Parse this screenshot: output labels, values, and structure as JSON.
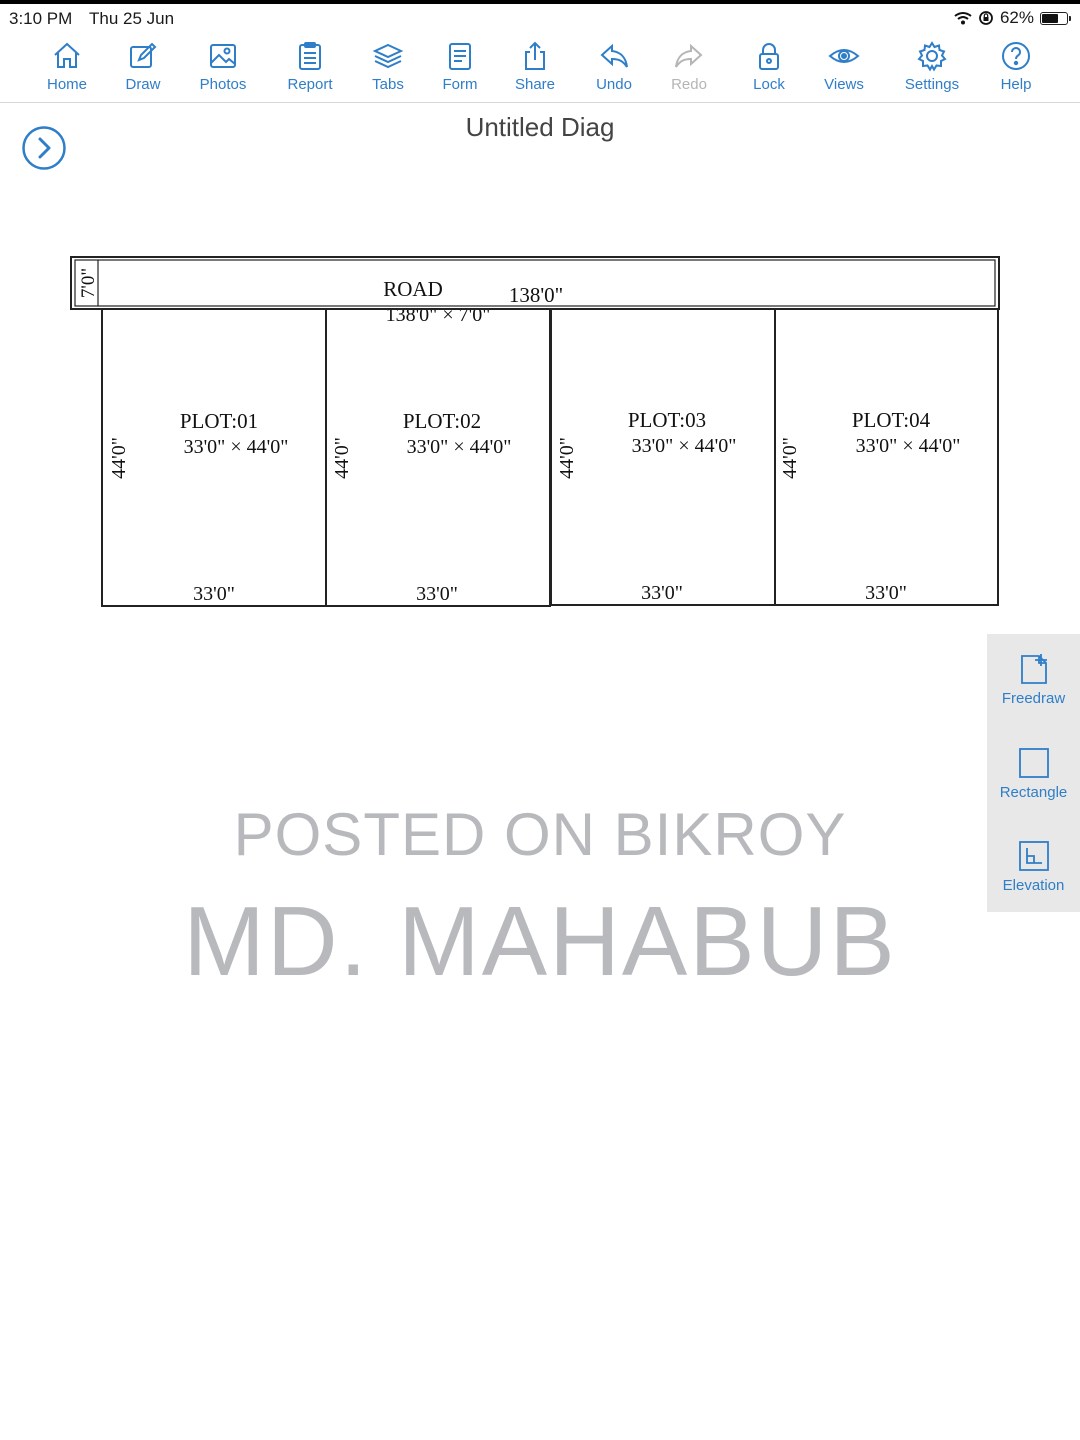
{
  "status": {
    "time": "3:10 PM",
    "date": "Thu 25 Jun",
    "battery": "62%"
  },
  "toolbar": [
    {
      "label": "Home",
      "icon": "home-icon"
    },
    {
      "label": "Draw",
      "icon": "draw-icon"
    },
    {
      "label": "Photos",
      "icon": "photos-icon"
    },
    {
      "label": "Report",
      "icon": "report-icon"
    },
    {
      "label": "Tabs",
      "icon": "tabs-icon"
    },
    {
      "label": "Form",
      "icon": "form-icon"
    },
    {
      "label": "Share",
      "icon": "share-icon"
    },
    {
      "label": "Undo",
      "icon": "undo-icon"
    },
    {
      "label": "Redo",
      "icon": "redo-icon"
    },
    {
      "label": "Lock",
      "icon": "lock-icon"
    },
    {
      "label": "Views",
      "icon": "views-icon"
    },
    {
      "label": "Settings",
      "icon": "settings-icon"
    },
    {
      "label": "Help",
      "icon": "help-icon"
    }
  ],
  "document": {
    "title": "Untitled Diag"
  },
  "drawing": {
    "road": {
      "label": "ROAD",
      "length": "138'0\"",
      "width": "7'0\"",
      "area": "138'0\" × 7'0\""
    },
    "plots": [
      {
        "name": "PLOT:01",
        "size": "33'0\" × 44'0\"",
        "depth": "44'0\"",
        "frontage": "33'0\""
      },
      {
        "name": "PLOT:02",
        "size": "33'0\" × 44'0\"",
        "depth": "44'0\"",
        "frontage": "33'0\""
      },
      {
        "name": "PLOT:03",
        "size": "33'0\" × 44'0\"",
        "depth": "44'0\"",
        "frontage": "33'0\""
      },
      {
        "name": "PLOT:04",
        "size": "33'0\" × 44'0\"",
        "depth": "44'0\"",
        "frontage": "33'0\""
      }
    ]
  },
  "side_tools": [
    {
      "label": "Freedraw",
      "icon": "freedraw-icon"
    },
    {
      "label": "Rectangle",
      "icon": "rectangle-icon"
    },
    {
      "label": "Elevation",
      "icon": "elevation-icon"
    }
  ],
  "watermark": {
    "line1": "POSTED ON BIKROY",
    "line2": "MD. MAHABUB"
  },
  "colors": {
    "accent": "#2f7ec8",
    "disabled": "#b5b5b5",
    "watermark": "#b7b9bc"
  }
}
